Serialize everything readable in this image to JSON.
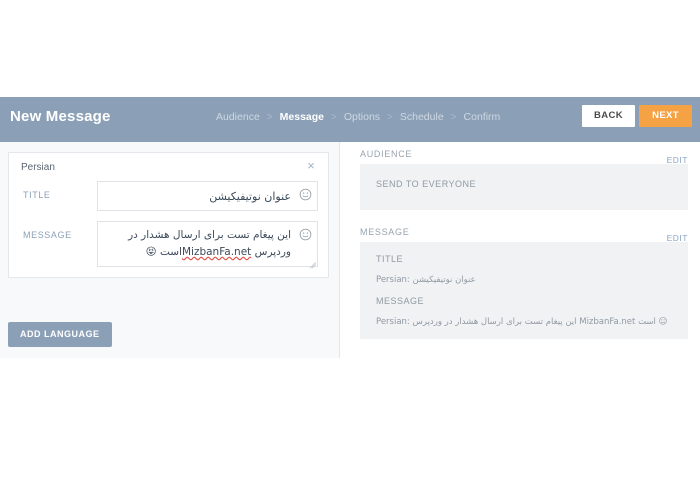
{
  "header": {
    "title": "New Message",
    "breadcrumb": [
      {
        "label": "Audience",
        "active": false
      },
      {
        "label": "Message",
        "active": true
      },
      {
        "label": "Options",
        "active": false
      },
      {
        "label": "Schedule",
        "active": false
      },
      {
        "label": "Confirm",
        "active": false
      }
    ],
    "separator": ">",
    "back_label": "BACK",
    "next_label": "NEXT",
    "bg_color": "#8ba0b6",
    "next_color": "#f5a244"
  },
  "editor": {
    "language_name": "Persian",
    "close_icon": "×",
    "title_label": "TITLE",
    "title_value": "عنوان نوتیفیکیشن",
    "title_placeholder": "",
    "message_label": "MESSAGE",
    "message_value": "این پیغام تست برای ارسال هشدار در وردپرس MizbanFa.net است 😝",
    "message_part_1": "این پیغام تست برای ارسال هشدار در وردپرس",
    "message_misspelled": "MizbanFa.net",
    "message_part_2": "است",
    "message_emoji": "😝",
    "message_placeholder": "",
    "emoji_picker_icon": "smiley-face",
    "add_language_label": "ADD LANGUAGE"
  },
  "summary": {
    "audience": {
      "section_label": "AUDIENCE",
      "edit_label": "EDIT",
      "value": "SEND TO EVERYONE"
    },
    "message": {
      "section_label": "MESSAGE",
      "edit_label": "EDIT",
      "title_label": "TITLE",
      "title_value": "Persian: عنوان نوتیفیکیشن",
      "message_label": "MESSAGE",
      "message_value": "Persian: این پیغام تست برای ارسال هشدار در وردپرس MizbanFa.net است ☺"
    }
  }
}
